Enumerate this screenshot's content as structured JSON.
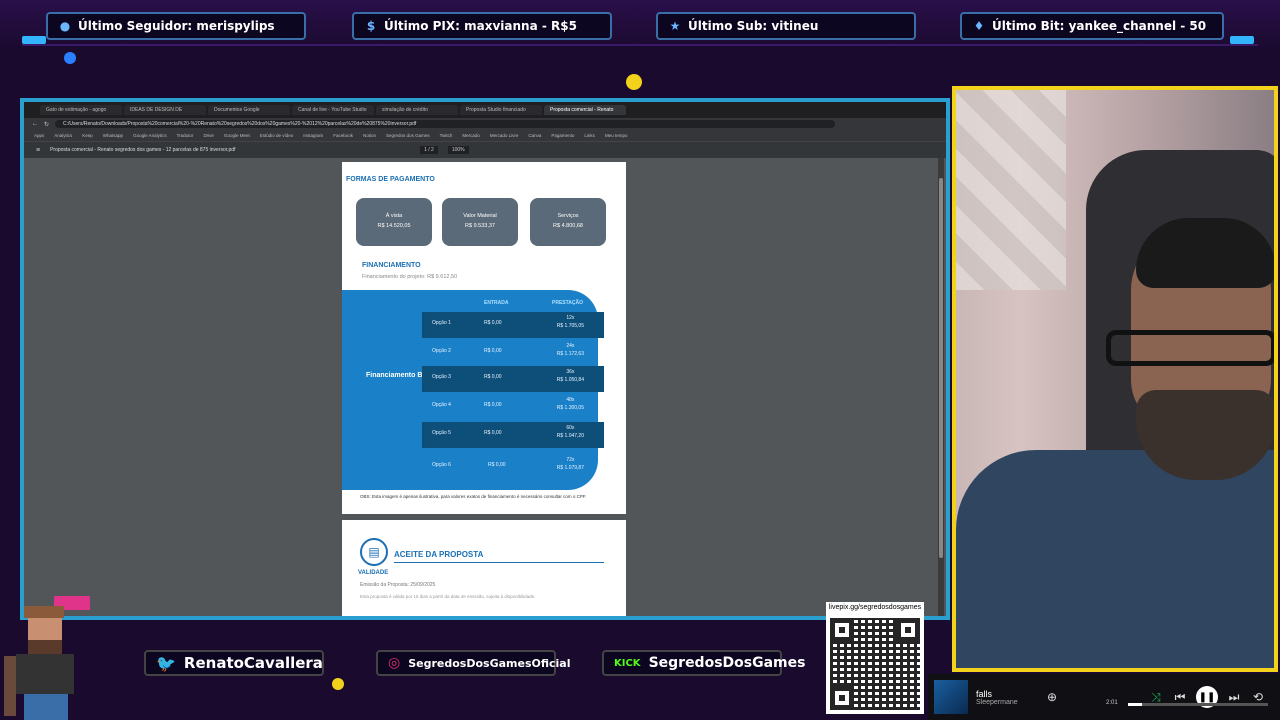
{
  "alerts": {
    "follower": "Último Seguidor: merispylips",
    "pix": "Último PIX: maxvianna - R$5",
    "sub": "Último Sub: vitineu",
    "bit": "Último Bit: yankee_channel - 50"
  },
  "browser": {
    "tabs": [
      "Gato de estimação - agogo",
      "IDEAS DE DESIGN DE",
      "Documentos Google",
      "Canal de live - YouTube Studio",
      "simulação de crédito",
      "Proposta Studio financiado",
      "Proposta comercial - Renato"
    ],
    "url": "C:/Users/Renato/Downloads/Proposta%20comercial%20-%20Renato%20segredos%20dos%20games%20-%2012%20parcelas%20de%20875%20inversor.pdf",
    "bookmarks": [
      "Apps",
      "Analytics",
      "Keep",
      "Whatsapp",
      "Google Analytics",
      "Tradutor",
      "Drive",
      "Google Meet",
      "Estúdio de vídeo",
      "Instagram",
      "Facebook",
      "Notion",
      "Segredos dos Games",
      "Twitch",
      "Mercado",
      "Mercado Livre",
      "Canva",
      "Pagamento",
      "Links",
      "Meu tempo"
    ],
    "pdf_title": "Proposta comercial - Renato segredos dos games - 12 parcelas de 875 inversor.pdf",
    "page_indicator": "1 / 2",
    "zoom": "100%"
  },
  "proposal": {
    "payment_title": "FORMAS DE PAGAMENTO",
    "payment_options": [
      {
        "label": "À vista",
        "value": "R$ 14.520,05"
      },
      {
        "label": "Valor Material",
        "value": "R$ 9.533,37"
      },
      {
        "label": "Serviços",
        "value": "R$ 4.800,68"
      }
    ],
    "financing_title": "FINANCIAMENTO",
    "financing_sub": "Financiamento do projeto: R$ 9.612,50",
    "financing_label": "Financiamento BV",
    "col_entry": "ENTRADA",
    "col_installment": "PRESTAÇÃO",
    "rows": [
      {
        "option": "Opção 1",
        "entry": "R$ 0,00",
        "term": "12x",
        "amount": "R$ 1.705,05"
      },
      {
        "option": "Opção 2",
        "entry": "R$ 0,00",
        "term": "24x",
        "amount": "R$ 1.172,63"
      },
      {
        "option": "Opção 3",
        "entry": "R$ 0,00",
        "term": "36x",
        "amount": "R$ 1.050,84"
      },
      {
        "option": "Opção 4",
        "entry": "R$ 0,00",
        "term": "48x",
        "amount": "R$ 1.300,05"
      },
      {
        "option": "Opção 5",
        "entry": "R$ 0,00",
        "term": "60x",
        "amount": "R$ 1.047,20"
      },
      {
        "option": "Opção 6",
        "entry": "R$ 0,00",
        "term": "72x",
        "amount": "R$ 1.079,87"
      }
    ],
    "obs": "OBS: Esta imagem é apenas ilustrativa, para valores exatos de financiamento é necessário consultar com o CPF.",
    "accept_title": "ACEITE DA PROPOSTA",
    "validity_title": "VALIDADE",
    "validity_line": "Emissão da Proposta: 25/09/2025",
    "validity_note": "Esta proposta é válida por 15 dias a partir da data de emissão, sujeita à disponibilidade."
  },
  "social": {
    "twitter": "RenatoCavallera",
    "instagram": "SegredosDosGamesOficial",
    "kick_tag": "KICK",
    "kick": "SegredosDosGames"
  },
  "qr_label": "livepix.gg/segredosdosgames",
  "player": {
    "track": "falls",
    "artist": "Sleepermane",
    "time": "2:01",
    "progress": 0.1
  }
}
